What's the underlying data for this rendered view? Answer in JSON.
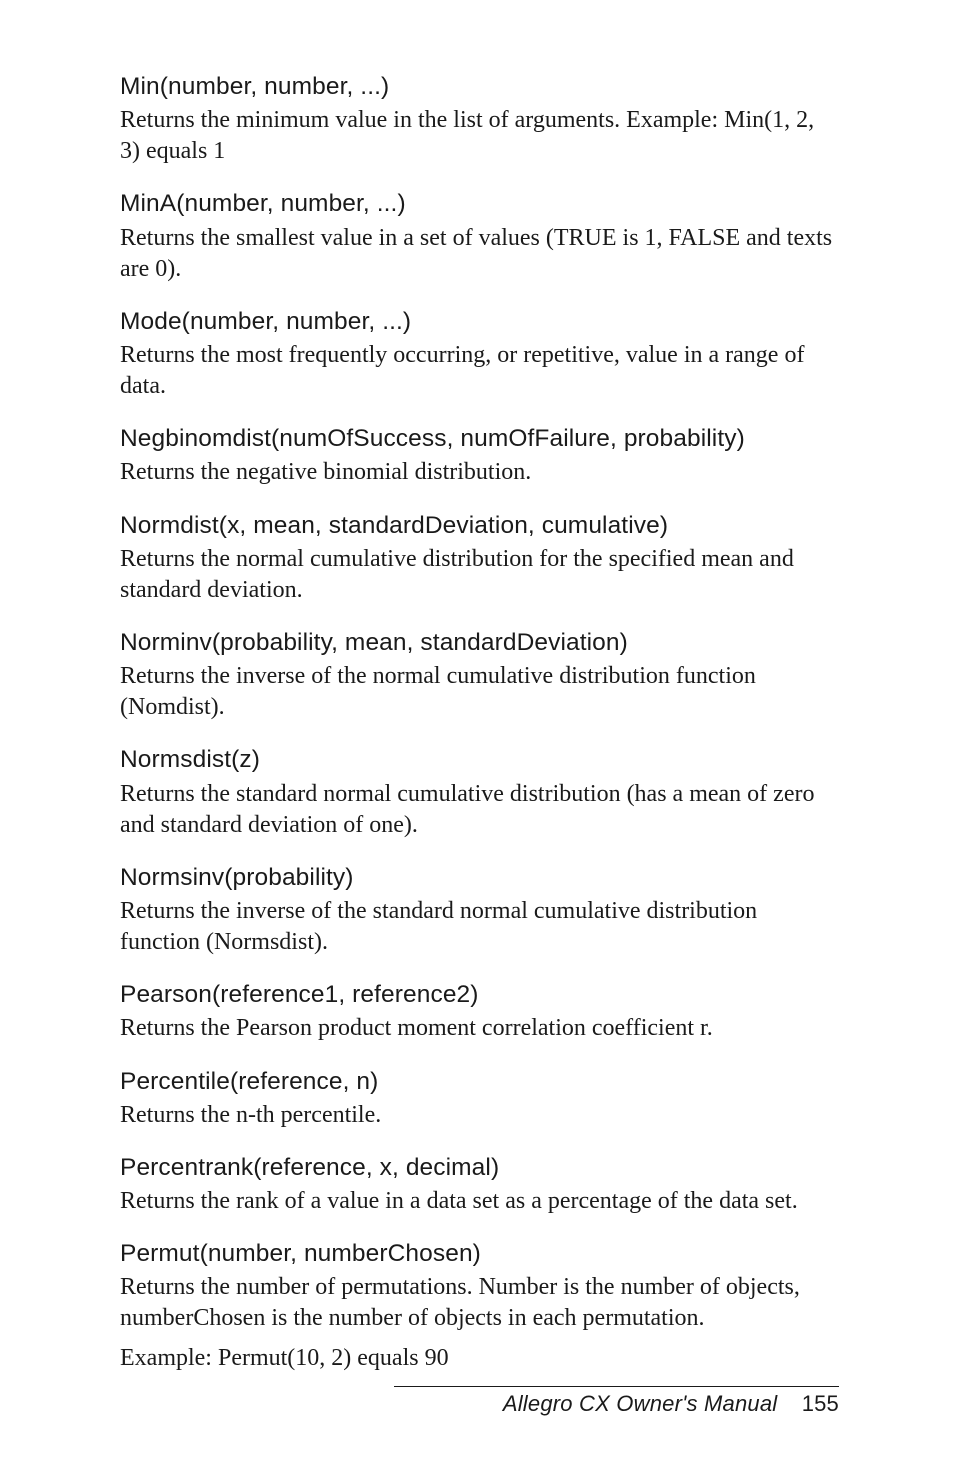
{
  "entries": [
    {
      "heading": "Min(number, number, ...)",
      "body": "Returns the minimum value in the list of arguments. Example: Min(1, 2, 3) equals 1"
    },
    {
      "heading": "MinA(number, number, ...)",
      "body": "Returns the smallest value in a set of values (TRUE is 1, FALSE and texts are 0)."
    },
    {
      "heading": "Mode(number, number, ...)",
      "body": "Returns the most frequently occurring, or repetitive, value in a range of data."
    },
    {
      "heading": "Negbinomdist(numOfSuccess, numOfFailure, probability)",
      "body": "Returns the negative binomial distribution."
    },
    {
      "heading": "Normdist(x, mean, standardDeviation, cumulative)",
      "body": "Returns the normal cumulative distribution for the specified mean and standard deviation."
    },
    {
      "heading": "Norminv(probability, mean, standardDeviation)",
      "body": "Returns the inverse of the normal cumulative distribution function (Nomdist)."
    },
    {
      "heading": "Normsdist(z)",
      "body": "Returns the standard normal cumulative distribution (has a mean of zero and standard deviation of one)."
    },
    {
      "heading": "Normsinv(probability)",
      "body": "Returns the inverse of the standard normal cumulative distribution function (Normsdist)."
    },
    {
      "heading": "Pearson(reference1, reference2)",
      "body": "Returns the Pearson product moment correlation coefficient r."
    },
    {
      "heading": "Percentile(reference, n)",
      "body": "Returns the n-th percentile."
    },
    {
      "heading": "Percentrank(reference, x, decimal)",
      "body": "Returns the rank of a value in a data set as a percentage of the data set."
    },
    {
      "heading": "Permut(number, numberChosen)",
      "body": "Returns the number of permutations. Number is the number of objects, numberChosen is the number of objects in each permutation.",
      "extra": "Example: Permut(10, 2) equals 90"
    }
  ],
  "footer": {
    "title": "Allegro CX Owner's Manual",
    "page": "155"
  }
}
